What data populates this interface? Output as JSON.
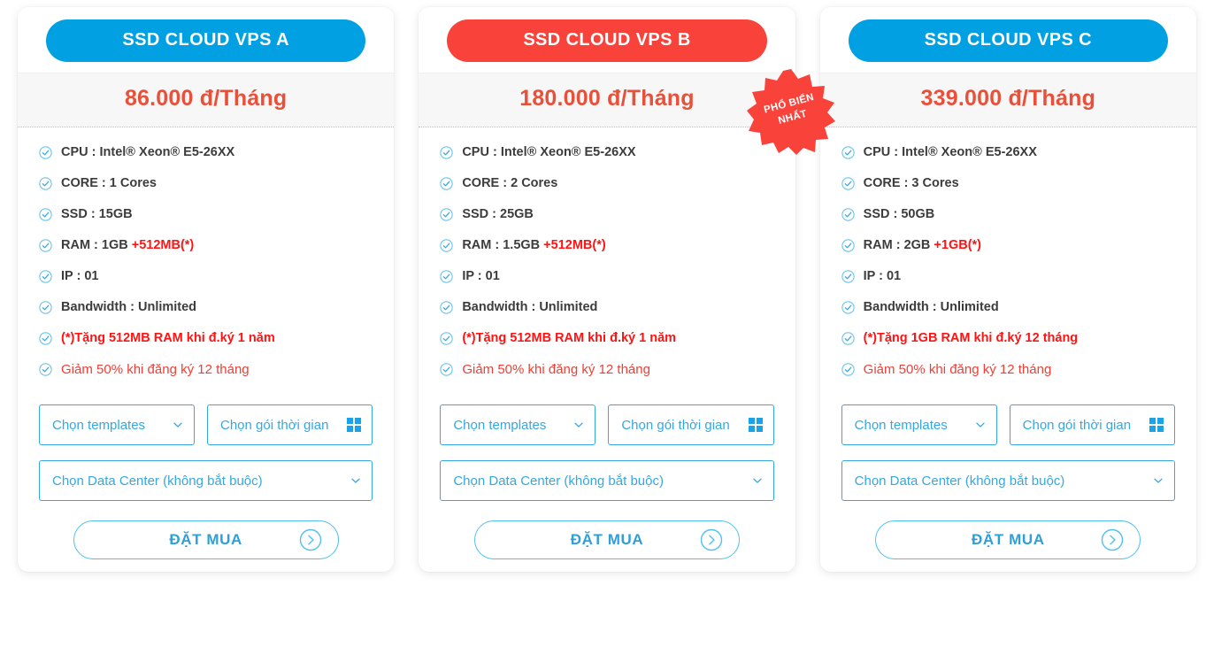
{
  "page": {
    "background_color": "#ffffff",
    "accent_blue": "#00a0e3",
    "accent_red": "#f9423a",
    "price_color": "#e8503a",
    "bonus_color": "#ff1313",
    "select_border_color": "#35a8e0"
  },
  "badge": {
    "line1": "PHỔ BIẾN",
    "line2": "NHẤT",
    "color": "#f9423a"
  },
  "common": {
    "select_templates_label": "Chọn templates",
    "select_duration_label": "Chọn gói thời gian",
    "select_datacenter_label": "Chọn Data Center (không bắt buộc)",
    "order_button_label": "ĐẶT MUA",
    "templates_icon": "chevron-down-icon",
    "duration_icon": "grid-icon",
    "datacenter_icon": "chevron-down-icon",
    "order_icon": "arrow-right-circle-icon",
    "feature_icon": "check-circle-icon"
  },
  "cards": [
    {
      "title": "SSD CLOUD VPS A",
      "title_bg": "#00a0e3",
      "price": "86.000 đ/Tháng",
      "popular": false,
      "features": [
        {
          "label": "CPU : Intel® Xeon® E5-26XX",
          "bonus": "",
          "style": "normal"
        },
        {
          "label": "CORE : 1 Cores",
          "bonus": "",
          "style": "normal"
        },
        {
          "label": "SSD : 15GB",
          "bonus": "",
          "style": "normal"
        },
        {
          "label": "RAM : 1GB ",
          "bonus": "+512MB(*)",
          "style": "normal"
        },
        {
          "label": "IP : 01",
          "bonus": "",
          "style": "normal"
        },
        {
          "label": "Bandwidth : Unlimited",
          "bonus": "",
          "style": "normal"
        },
        {
          "label": "(*)Tặng 512MB RAM khi đ.ký 1 năm",
          "bonus": "",
          "style": "red"
        },
        {
          "label": "Giảm 50% khi đăng ký 12 tháng",
          "bonus": "",
          "style": "red-light"
        }
      ]
    },
    {
      "title": "SSD CLOUD VPS B",
      "title_bg": "#f9423a",
      "price": "180.000 đ/Tháng",
      "popular": true,
      "features": [
        {
          "label": "CPU : Intel® Xeon® E5-26XX",
          "bonus": "",
          "style": "normal"
        },
        {
          "label": "CORE : 2 Cores",
          "bonus": "",
          "style": "normal"
        },
        {
          "label": "SSD : 25GB",
          "bonus": "",
          "style": "normal"
        },
        {
          "label": "RAM : 1.5GB ",
          "bonus": "+512MB(*)",
          "style": "normal"
        },
        {
          "label": "IP : 01",
          "bonus": "",
          "style": "normal"
        },
        {
          "label": "Bandwidth : Unlimited",
          "bonus": "",
          "style": "normal"
        },
        {
          "label": "(*)Tặng 512MB RAM khi đ.ký 1 năm",
          "bonus": "",
          "style": "red"
        },
        {
          "label": "Giảm 50% khi đăng ký 12 tháng",
          "bonus": "",
          "style": "red-light"
        }
      ]
    },
    {
      "title": "SSD CLOUD VPS C",
      "title_bg": "#00a0e3",
      "price": "339.000 đ/Tháng",
      "popular": false,
      "features": [
        {
          "label": "CPU : Intel® Xeon® E5-26XX",
          "bonus": "",
          "style": "normal"
        },
        {
          "label": "CORE : 3 Cores",
          "bonus": "",
          "style": "normal"
        },
        {
          "label": "SSD : 50GB",
          "bonus": "",
          "style": "normal"
        },
        {
          "label": "RAM : 2GB ",
          "bonus": "+1GB(*)",
          "style": "normal"
        },
        {
          "label": "IP : 01",
          "bonus": "",
          "style": "normal"
        },
        {
          "label": "Bandwidth : Unlimited",
          "bonus": "",
          "style": "normal"
        },
        {
          "label": "(*)Tặng 1GB RAM khi đ.ký 12 tháng",
          "bonus": "",
          "style": "red"
        },
        {
          "label": "Giảm 50% khi đăng ký 12 tháng",
          "bonus": "",
          "style": "red-light"
        }
      ]
    }
  ]
}
